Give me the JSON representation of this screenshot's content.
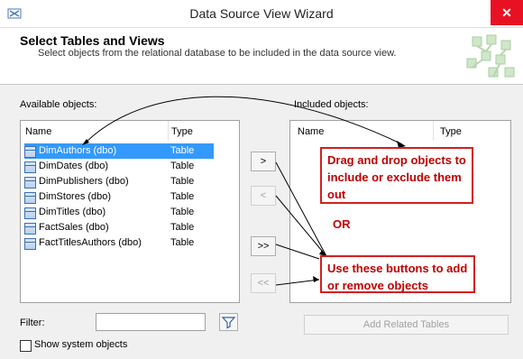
{
  "window": {
    "title": "Data Source View Wizard",
    "close_glyph": "✕"
  },
  "header": {
    "title": "Select Tables and Views",
    "subtitle": "Select objects from the relational database to be included in the data source view."
  },
  "available": {
    "label": "Available objects:",
    "columns": [
      "Name",
      "Type"
    ],
    "rows": [
      {
        "name": "DimAuthors (dbo)",
        "type": "Table",
        "selected": true
      },
      {
        "name": "DimDates (dbo)",
        "type": "Table"
      },
      {
        "name": "DimPublishers (dbo)",
        "type": "Table"
      },
      {
        "name": "DimStores (dbo)",
        "type": "Table"
      },
      {
        "name": "DimTitles (dbo)",
        "type": "Table"
      },
      {
        "name": "FactSales (dbo)",
        "type": "Table"
      },
      {
        "name": "FactTitlesAuthors (dbo)",
        "type": "Table"
      }
    ]
  },
  "included": {
    "label": "Included objects:",
    "columns": [
      "Name",
      "Type"
    ]
  },
  "move_buttons": {
    "add": ">",
    "remove": "<",
    "add_all": ">>",
    "remove_all": "<<"
  },
  "filter": {
    "label": "Filter:",
    "value": ""
  },
  "add_related": "Add Related Tables",
  "show_system": {
    "label": "Show system objects",
    "checked": false
  },
  "annotations": {
    "drag_drop": "Drag and drop objects to include or exclude them out",
    "or": "OR",
    "buttons": "Use these buttons to add or remove objects",
    "color": "#c00000"
  }
}
